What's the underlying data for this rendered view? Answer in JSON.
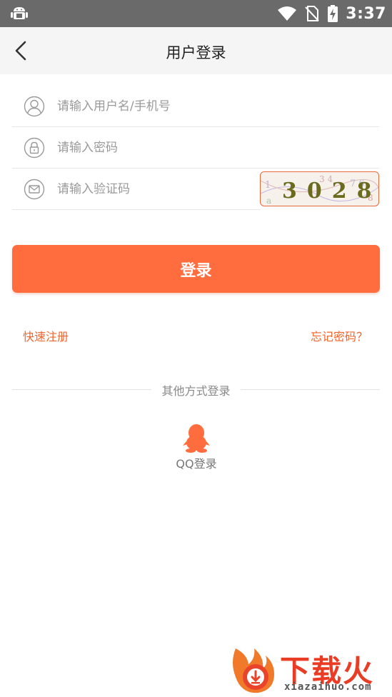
{
  "status_bar": {
    "time": "3:37",
    "icons": [
      "android-debug-icon",
      "wifi-icon",
      "no-sim-icon",
      "battery-charging-icon"
    ]
  },
  "header": {
    "title": "用户登录",
    "back_icon": "chevron-left-icon"
  },
  "form": {
    "username": {
      "placeholder": "请输入用户名/手机号",
      "value": "",
      "icon": "user-icon"
    },
    "password": {
      "placeholder": "请输入密码",
      "value": "",
      "icon": "lock-icon"
    },
    "captcha": {
      "placeholder": "请输入验证码",
      "value": "",
      "icon": "mail-icon",
      "image_text": "3028"
    }
  },
  "login_button": {
    "label": "登录"
  },
  "links": {
    "register": "快速注册",
    "forgot": "忘记密码？"
  },
  "other_login": {
    "label": "其他方式登录",
    "qq_label": "QQ登录",
    "qq_icon": "qq-penguin-icon"
  },
  "watermark": {
    "brand": "下载火",
    "url": "xiazaihuo.com"
  },
  "colors": {
    "accent": "#ff6d3f",
    "link": "#f0652b",
    "status_bar": "#6a6a6a",
    "header_bg": "#f5f5f5"
  }
}
